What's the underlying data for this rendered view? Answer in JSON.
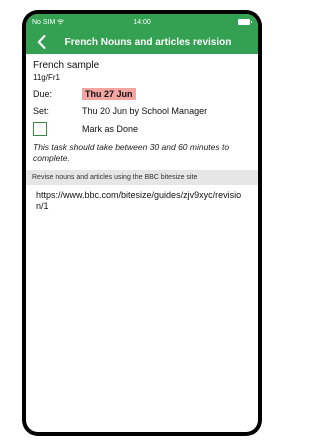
{
  "status_bar": {
    "carrier": "No SIM",
    "time": "14:00"
  },
  "nav": {
    "title": "French Nouns and articles revision",
    "back_icon": "chevron-left-icon"
  },
  "task": {
    "subject": "French sample",
    "group": "11g/Fr1",
    "due_label": "Due:",
    "due_value": "Thu 27 Jun",
    "set_label": "Set:",
    "set_value": "Thu 20 Jun by  School Manager",
    "mark_done_label": "Mark as Done",
    "note": "This task should take between 30 and 60 minutes to complete."
  },
  "resource": {
    "heading": "Revise nouns and articles using the BBC bitesize site",
    "link": "https://www.bbc.com/bitesize/guides/zjv9xyc/revision/1"
  },
  "colors": {
    "header": "#33a052",
    "due_highlight": "#f3a5a2",
    "checkbox": "#3a8a4a"
  }
}
